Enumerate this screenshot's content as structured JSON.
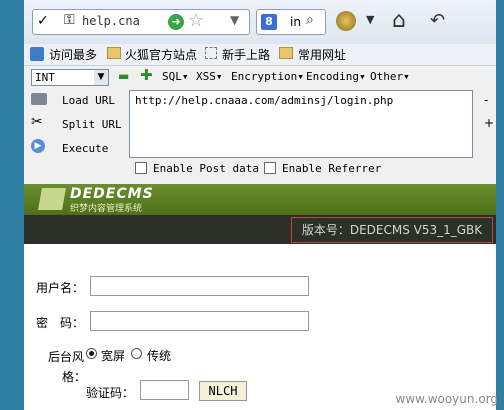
{
  "browser": {
    "url_short": "help.cna",
    "search_text": "in",
    "bookmarks": [
      "访问最多",
      "火狐官方站点",
      "新手上路",
      "常用网址"
    ]
  },
  "hackbar": {
    "select": "INT",
    "menus": [
      "SQL▾",
      "XSS▾",
      "Encryption▾",
      "Encoding▾",
      "Other▾"
    ],
    "load": "Load URL",
    "split": "Split URL",
    "execute": "Execute",
    "url": "http://help.cnaaa.com/adminsj/login.php",
    "post": "Enable Post data",
    "referrer": "Enable Referrer",
    "minus": "-",
    "plus": "+"
  },
  "site": {
    "logo_text": "DEDECMS",
    "logo_sub": "织梦内容管理系统",
    "version": "版本号：DEDECMS V53_1_GBK"
  },
  "form": {
    "username_label": "用户名：",
    "password_label": "密　码：",
    "style_label_1": "后台风",
    "style_label_2": "格：",
    "style_opt1": "宽屏",
    "style_opt2": "传统",
    "captcha_label": "验证码：",
    "captcha": "NLCH"
  },
  "watermark": "www.wooyun.org"
}
